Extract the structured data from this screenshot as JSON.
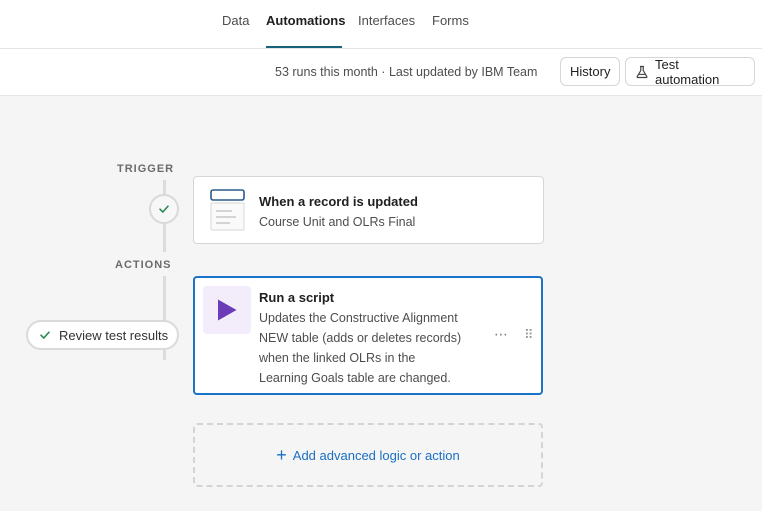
{
  "nav": {
    "tabs": [
      {
        "label": "Data"
      },
      {
        "label": "Automations"
      },
      {
        "label": "Interfaces"
      },
      {
        "label": "Forms"
      }
    ],
    "active_tab": "Automations"
  },
  "toolbar": {
    "runs_text": "53 runs this month · Last updated by IBM Team",
    "history_label": "History",
    "test_label": "Test automation",
    "test_icon": "flask-icon"
  },
  "flow": {
    "trigger_label": "TRIGGER",
    "actions_label": "ACTIONS",
    "trigger": {
      "title": "When a record is updated",
      "subtitle": "Course Unit and OLRs Final",
      "icon": "record-form-icon"
    },
    "action": {
      "title": "Run a script",
      "description": [
        "Updates the Constructive Alignment",
        "NEW table (adds or deletes records)",
        "when the linked OLRs in the",
        "Learning Goals table are changed."
      ],
      "icon": "play-script-icon",
      "more": "⋯",
      "drag": "⠿",
      "icon_color": "#6b3bb8",
      "icon_bg": "#f3ecfb",
      "accent": "#1a73c8"
    },
    "review_label": "Review test results",
    "add_label": "Add advanced logic or action",
    "add_symbol": "+"
  },
  "colors": {
    "tab_underline": "#16627a",
    "link": "#1a6fc4",
    "check": "#2e8b57"
  }
}
